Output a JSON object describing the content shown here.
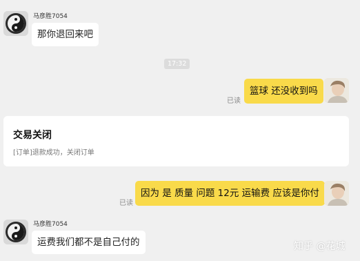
{
  "messages": {
    "m1": {
      "sender": "马彦胜7054",
      "text": "那你退回来吧"
    },
    "timestamp": "17:32",
    "m2": {
      "text": "篮球 还没收到吗",
      "status": "已读"
    },
    "order_card": {
      "title": "交易关闭",
      "detail": "[订单]退款成功，关闭订单"
    },
    "m3": {
      "text": "因为 是 质量 问题 12元 运输费 应该是你付",
      "status": "已读"
    },
    "m4": {
      "sender": "马彦胜7054",
      "text": "运费我们都不是自己付的"
    }
  },
  "watermark": "知乎 @花城",
  "colors": {
    "background": "#f0f0f0",
    "outgoing_bubble": "#f9da4a",
    "incoming_bubble": "#ffffff",
    "read_status": "#8a8a8a"
  },
  "icons": {
    "contact_avatar": "yin-yang-avatar-icon",
    "self_avatar": "user-photo-avatar"
  }
}
